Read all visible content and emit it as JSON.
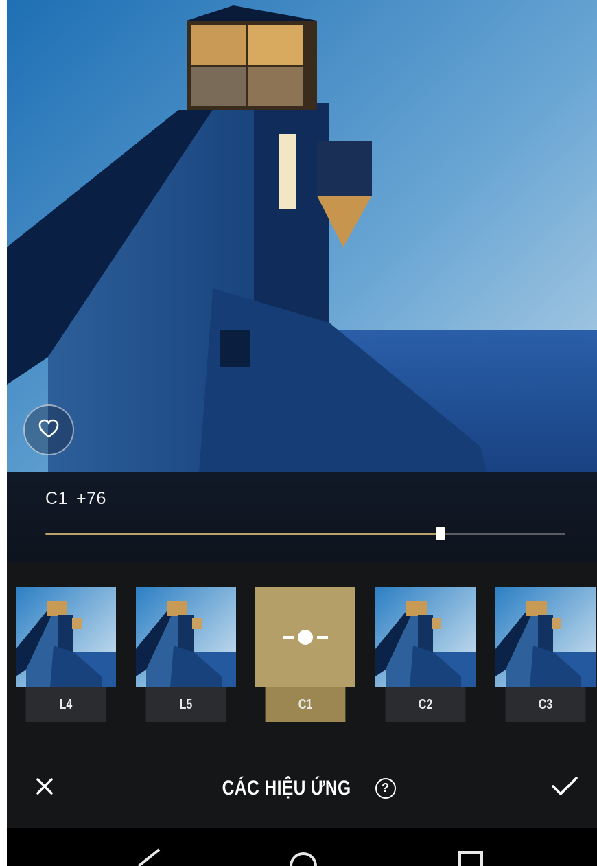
{
  "adjustment": {
    "filter_name": "C1",
    "strength_text": "+76",
    "strength_value": 76,
    "strength_max": 100
  },
  "presets": [
    {
      "label": "L4",
      "active": false
    },
    {
      "label": "L5",
      "active": false
    },
    {
      "label": "C1",
      "active": true
    },
    {
      "label": "C2",
      "active": false
    },
    {
      "label": "C3",
      "active": false
    }
  ],
  "toolbar": {
    "title": "CÁC HIỆU ỨNG",
    "help_glyph": "?",
    "cancel_icon": "close-icon",
    "confirm_icon": "checkmark-icon"
  },
  "icons": {
    "favorite": "heart-icon",
    "nav_back": "triangle-back-icon",
    "nav_home": "circle-home-icon",
    "nav_recents": "square-recents-icon"
  },
  "colors": {
    "accent_gold": "#b59f69",
    "slider_fill": "#b9a36a",
    "background": "#151618"
  }
}
